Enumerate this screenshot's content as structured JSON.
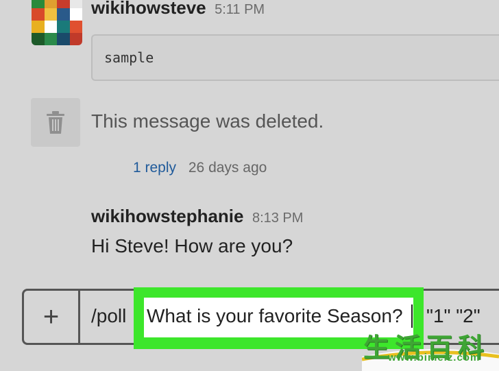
{
  "messages": {
    "first": {
      "username": "wikihowsteve",
      "time": "5:11 PM",
      "code": "sample"
    },
    "deleted": {
      "text": "This message was deleted.",
      "icon": "trash-icon",
      "reply_link": "1 reply",
      "reply_ago": "26 days ago"
    },
    "second": {
      "username": "wikihowstephanie",
      "time": "8:13 PM",
      "text": "Hi Steve! How are you?"
    }
  },
  "composer": {
    "plus": "+",
    "prefix": "/poll",
    "highlighted": "What is your favorite Season?",
    "suffix": "\"1\" \"2\""
  },
  "watermark": {
    "chars": "生活百科",
    "url": "www.bimeiz.com"
  },
  "colors": {
    "highlight": "#3de62b",
    "link": "#1f5a9a",
    "background": "#d6d6d6"
  }
}
